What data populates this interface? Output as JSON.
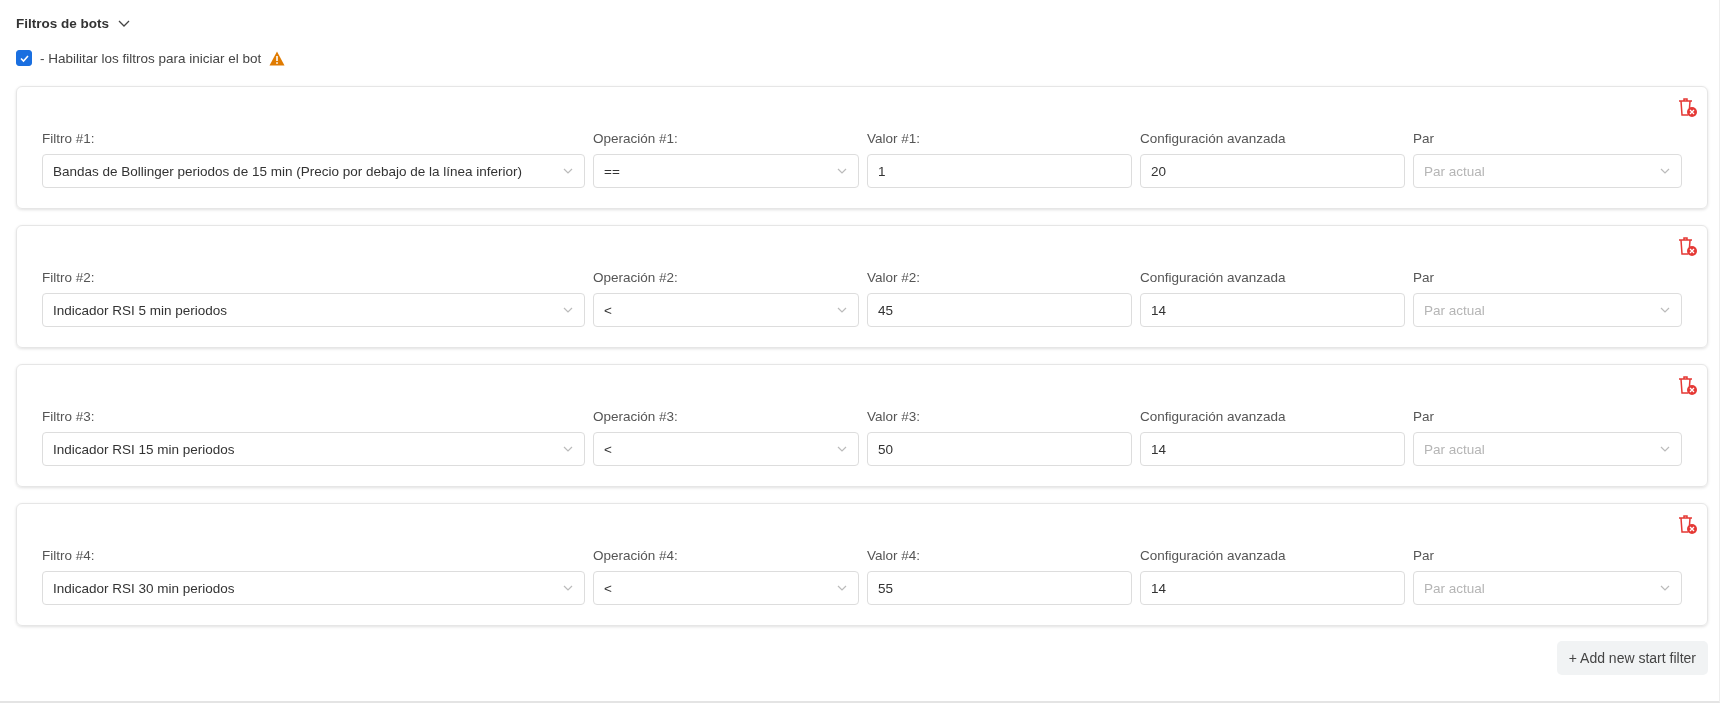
{
  "section": {
    "title": "Filtros de bots",
    "expanded": true
  },
  "enable": {
    "label": "- Habilitar los filtros para iniciar el bot",
    "checked": true
  },
  "filters": [
    {
      "filter_label": "Filtro #1:",
      "filter_value": "Bandas de Bollinger periodos de 15 min (Precio por debajo de la línea inferior)",
      "op_label": "Operación #1:",
      "op_value": "==",
      "value_label": "Valor #1:",
      "value": "1",
      "config_label": "Configuración avanzada",
      "config_value": "20",
      "pair_label": "Par",
      "pair_placeholder": "Par actual"
    },
    {
      "filter_label": "Filtro #2:",
      "filter_value": "Indicador RSI 5 min periodos",
      "op_label": "Operación #2:",
      "op_value": "<",
      "value_label": "Valor #2:",
      "value": "45",
      "config_label": "Configuración avanzada",
      "config_value": "14",
      "pair_label": "Par",
      "pair_placeholder": "Par actual"
    },
    {
      "filter_label": "Filtro #3:",
      "filter_value": "Indicador RSI 15 min periodos",
      "op_label": "Operación #3:",
      "op_value": "<",
      "value_label": "Valor #3:",
      "value": "50",
      "config_label": "Configuración avanzada",
      "config_value": "14",
      "pair_label": "Par",
      "pair_placeholder": "Par actual"
    },
    {
      "filter_label": "Filtro #4:",
      "filter_value": "Indicador RSI 30 min periodos",
      "op_label": "Operación #4:",
      "op_value": "<",
      "value_label": "Valor #4:",
      "value": "55",
      "config_label": "Configuración avanzada",
      "config_value": "14",
      "pair_label": "Par",
      "pair_placeholder": "Par actual"
    }
  ],
  "add_button": "+ Add new start filter"
}
